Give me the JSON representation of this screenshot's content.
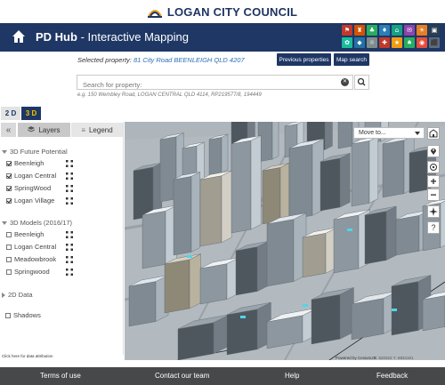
{
  "council": {
    "logo_text": "LOGAN CITY COUNCIL"
  },
  "header": {
    "app_name": "PD Hub",
    "app_subtitle": " - Interactive Mapping",
    "app_tiles": [
      {
        "color": "#c0392b",
        "glyph": "⚑"
      },
      {
        "color": "#d35400",
        "glyph": "♜"
      },
      {
        "color": "#27ae60",
        "glyph": "♣"
      },
      {
        "color": "#2980b9",
        "glyph": "♦"
      },
      {
        "color": "#16a085",
        "glyph": "⌂"
      },
      {
        "color": "#8e44ad",
        "glyph": "✉"
      },
      {
        "color": "#e67e22",
        "glyph": "☀"
      },
      {
        "color": "#2c3e50",
        "glyph": "▣"
      },
      {
        "color": "#1abc9c",
        "glyph": "✿"
      },
      {
        "color": "#2471a3",
        "glyph": "◆"
      },
      {
        "color": "#7f8c8d",
        "glyph": "☼"
      },
      {
        "color": "#c0392b",
        "glyph": "✚"
      },
      {
        "color": "#f39c12",
        "glyph": "★"
      },
      {
        "color": "#27ae60",
        "glyph": "♠"
      },
      {
        "color": "#e74c3c",
        "glyph": "◉"
      },
      {
        "color": "#5d6d7e",
        "glyph": "⬛"
      }
    ]
  },
  "property": {
    "label": "Selected property:",
    "address": "81 City Road BEENLEIGH QLD 4207",
    "previous_button": "Previous properties",
    "map_search_button": "Map search"
  },
  "search": {
    "placeholder": "Search for property:",
    "hint": "e.g. 150 Wembley Road, LOGAN CENTRAL QLD 4114, RP219577/8, 194449"
  },
  "view_mode": {
    "btn_2d": "2 D",
    "btn_3d": "3 D",
    "active": "3D"
  },
  "panel": {
    "tab_layers": "Layers",
    "tab_legend": "Legend",
    "group_future": "3D Future Potential",
    "future_items": [
      {
        "label": "Beenleigh",
        "checked": true
      },
      {
        "label": "Logan Central",
        "checked": true
      },
      {
        "label": "SpringWood",
        "checked": true
      },
      {
        "label": "Logan Village",
        "checked": true
      }
    ],
    "group_models": "3D Models (2016/17)",
    "model_items": [
      {
        "label": "Beenleigh",
        "checked": false
      },
      {
        "label": "Logan Central",
        "checked": false
      },
      {
        "label": "Meadowbrook",
        "checked": false
      },
      {
        "label": "Springwood",
        "checked": false
      }
    ],
    "group_2d": "2D Data",
    "shadows": "Shadows",
    "attribution": "Click here for data attribution"
  },
  "map": {
    "move_to": "Move to...",
    "powered_by": "Powered by CesiumJS",
    "coords": "X: 520322 Y: 6934101"
  },
  "footer": {
    "terms": "Terms of use",
    "contact": "Contact our team",
    "help": "Help",
    "feedback": "Feedback"
  }
}
